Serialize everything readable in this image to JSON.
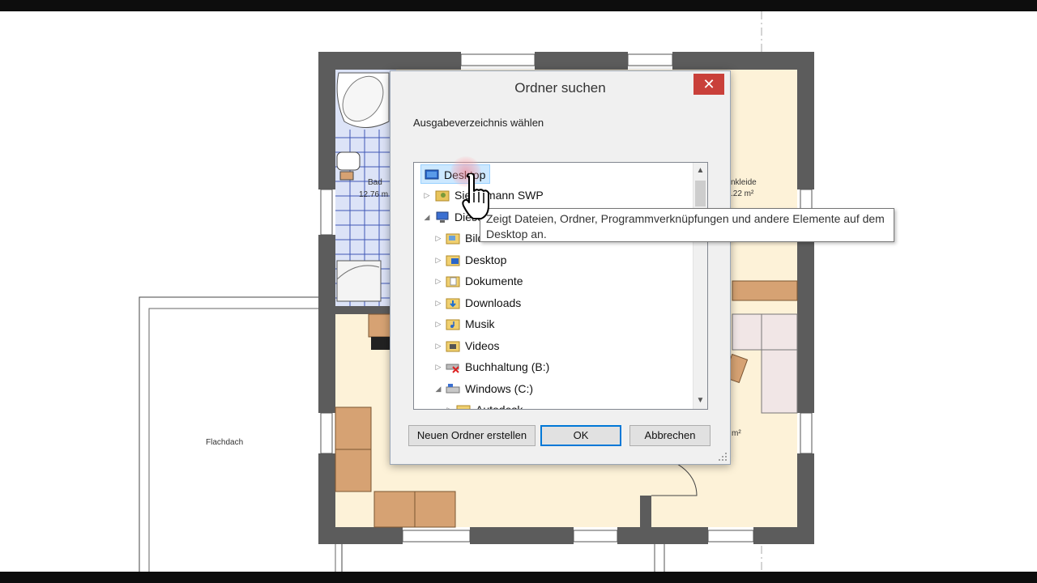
{
  "floorplan": {
    "labels": {
      "bath_name": "Bad",
      "bath_area": "12.76 m",
      "dressing_name": "nkleide",
      "dressing_area": ".22 m²",
      "flatroof": "Flachdach",
      "room_area_partial": "m²"
    },
    "colors": {
      "wall": "#5c5c5c",
      "floor_warm": "#fdf2d8",
      "tile_blue": "#dce3f7",
      "furniture": "#d6a273"
    }
  },
  "dialog": {
    "title": "Ordner suchen",
    "close_label": "✕",
    "description": "Ausgabeverzeichnis wählen",
    "tree": [
      {
        "label": "Desktop",
        "icon": "desktop-icon",
        "expander": "",
        "selected": true
      },
      {
        "label": "Sieglemann SWP",
        "icon": "user-folder-icon",
        "expander": "▷"
      },
      {
        "label": "Dieser PC",
        "icon": "computer-icon",
        "expander": "◢"
      },
      {
        "label": "Bilder",
        "icon": "pictures-folder-icon",
        "expander": "▷"
      },
      {
        "label": "Desktop",
        "icon": "desktop-folder-icon",
        "expander": "▷"
      },
      {
        "label": "Dokumente",
        "icon": "documents-folder-icon",
        "expander": "▷"
      },
      {
        "label": "Downloads",
        "icon": "downloads-folder-icon",
        "expander": "▷"
      },
      {
        "label": "Musik",
        "icon": "music-folder-icon",
        "expander": "▷"
      },
      {
        "label": "Videos",
        "icon": "videos-folder-icon",
        "expander": "▷"
      },
      {
        "label": "Buchhaltung (B:)",
        "icon": "network-drive-disconnected-icon",
        "expander": "▷"
      },
      {
        "label": "Windows (C:)",
        "icon": "drive-icon",
        "expander": "◢"
      },
      {
        "label": "Autodesk",
        "icon": "folder-icon",
        "expander": "▷"
      }
    ],
    "buttons": {
      "new_folder": "Neuen Ordner erstellen",
      "ok": "OK",
      "cancel": "Abbrechen"
    },
    "scroll": {
      "up": "▲",
      "down": "▼"
    },
    "colors": {
      "selection_bg": "#cce8ff",
      "close_bg": "#c9403a",
      "ok_border": "#0078d7"
    }
  },
  "tooltip": {
    "text": "Zeigt Dateien, Ordner, Programmverknüpfungen und andere Elemente auf dem Desktop an."
  },
  "cursor": {
    "icon": "hand-pointer-icon"
  }
}
